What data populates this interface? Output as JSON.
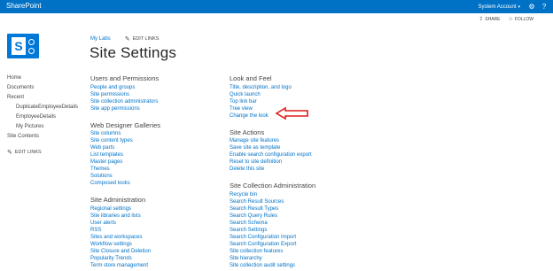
{
  "suite_bar": {
    "brand": "SharePoint",
    "user": "System Account",
    "user_caret": "▾",
    "gear_icon": "gear-icon",
    "help_label": "?"
  },
  "actions": {
    "share": "SHARE",
    "follow": "FOLLOW"
  },
  "logo": {
    "letter": "S",
    "icon": "sharepoint-logo"
  },
  "breadcrumb": {
    "site": "My Labs",
    "edit_links": "EDIT LINKS"
  },
  "page": {
    "title": "Site Settings"
  },
  "left_nav": {
    "items": [
      {
        "label": "Home"
      },
      {
        "label": "Documents"
      },
      {
        "label": "Recent"
      },
      {
        "label": "DuplicateEmployeeDetails"
      },
      {
        "label": "EmployeeDetails"
      },
      {
        "label": "My Pictures"
      },
      {
        "label": "Site Contents"
      }
    ],
    "edit_links": "EDIT LINKS"
  },
  "sections": {
    "users": {
      "title": "Users and Permissions",
      "links": [
        "People and groups",
        "Site permissions",
        "Site collection administrators",
        "Site app permissions"
      ]
    },
    "galleries": {
      "title": "Web Designer Galleries",
      "links": [
        "Site columns",
        "Site content types",
        "Web parts",
        "List templates",
        "Master pages",
        "Themes",
        "Solutions",
        "Composed looks"
      ]
    },
    "admin": {
      "title": "Site Administration",
      "links": [
        "Regional settings",
        "Site libraries and lists",
        "User alerts",
        "RSS",
        "Sites and workspaces",
        "Workflow settings",
        "Site Closure and Deletion",
        "Popularity Trends",
        "Term store management"
      ]
    },
    "look": {
      "title": "Look and Feel",
      "links": [
        "Title, description, and logo",
        "Quick launch",
        "Top link bar",
        "Tree view",
        "Change the look"
      ]
    },
    "actions": {
      "title": "Site Actions",
      "links": [
        "Manage site features",
        "Save site as template",
        "Enable search configuration export",
        "Reset to site definition",
        "Delete this site"
      ]
    },
    "collection": {
      "title": "Site Collection Administration",
      "links": [
        "Recycle bin",
        "Search Result Sources",
        "Search Result Types",
        "Search Query Rules",
        "Search Schema",
        "Search Settings",
        "Search Configuration Import",
        "Search Configuration Export",
        "Site collection features",
        "Site hierarchy",
        "Site collection audit settings"
      ]
    }
  },
  "colors": {
    "suite_bar": "#0072c6",
    "link": "#0072c6",
    "annotation_arrow": "#e01b1b"
  }
}
